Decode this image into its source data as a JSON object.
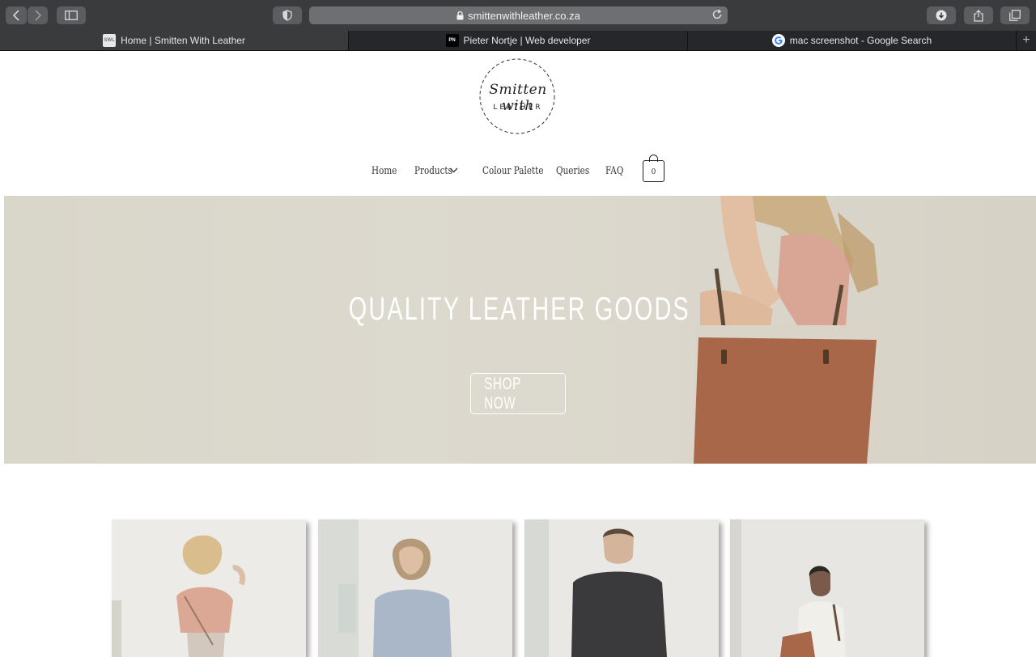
{
  "browser": {
    "url": "smittenwithleather.co.za",
    "tabs": [
      {
        "title": "Home | Smitten With Leather",
        "favicon": "SWL",
        "active": true
      },
      {
        "title": "Pieter Nortje | Web developer",
        "favicon": "PN",
        "active": false
      },
      {
        "title": "mac screenshot - Google Search",
        "favicon": "google-icon",
        "active": false
      }
    ]
  },
  "site": {
    "logo": {
      "line1": "Smitten with",
      "line2": "LEATHER"
    },
    "nav": [
      {
        "label": "Home"
      },
      {
        "label": "Products",
        "has_dropdown": true
      },
      {
        "label": "Colour Palette"
      },
      {
        "label": "Queries"
      },
      {
        "label": "FAQ"
      }
    ],
    "cart": {
      "count": "0"
    },
    "hero": {
      "title": "QUALITY LEATHER GOODS",
      "button": "SHOP NOW"
    },
    "cards": [
      {
        "name": "card-woman-pink-top"
      },
      {
        "name": "card-man-blue-shirt"
      },
      {
        "name": "card-man-black-shirt"
      },
      {
        "name": "card-woman-white-top"
      }
    ]
  },
  "colors": {
    "chrome_bg": "#3a3b3d",
    "tabbar_bg": "#26272a",
    "hero_bg": "#dbd7cc",
    "bag_brown": "#a9674a"
  }
}
